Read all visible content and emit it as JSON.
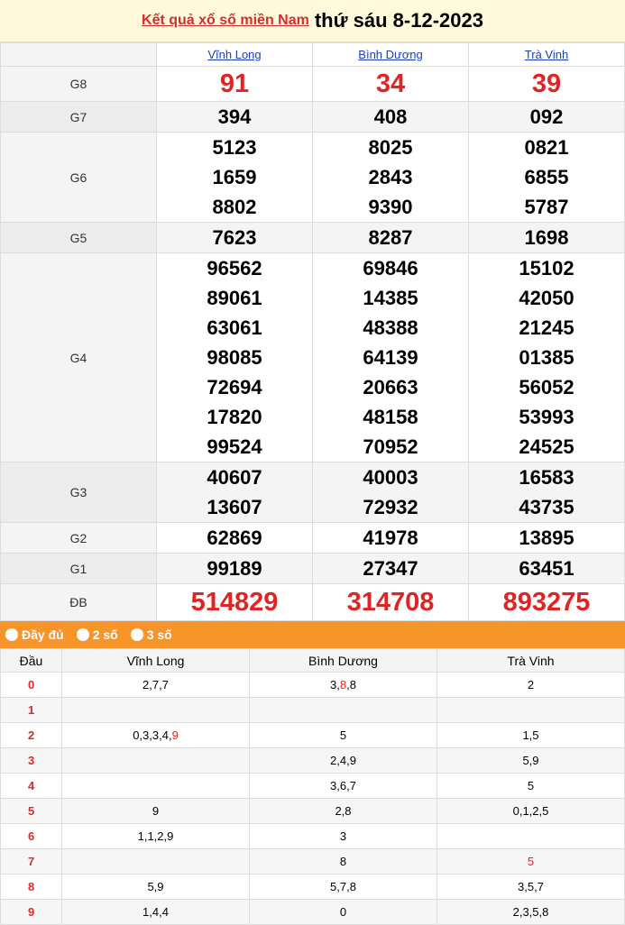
{
  "header": {
    "link_text": "Kết quả xổ số miền Nam",
    "date_text": "thứ sáu 8-12-2023"
  },
  "provinces": [
    "Vĩnh Long",
    "Bình Dương",
    "Trà Vinh"
  ],
  "prizes": [
    {
      "label": "G8",
      "values": [
        [
          "91"
        ],
        [
          "34"
        ],
        [
          "39"
        ]
      ]
    },
    {
      "label": "G7",
      "values": [
        [
          "394"
        ],
        [
          "408"
        ],
        [
          "092"
        ]
      ]
    },
    {
      "label": "G6",
      "values": [
        [
          "5123",
          "1659",
          "8802"
        ],
        [
          "8025",
          "2843",
          "9390"
        ],
        [
          "0821",
          "6855",
          "5787"
        ]
      ]
    },
    {
      "label": "G5",
      "values": [
        [
          "7623"
        ],
        [
          "8287"
        ],
        [
          "1698"
        ]
      ]
    },
    {
      "label": "G4",
      "values": [
        [
          "96562",
          "89061",
          "63061",
          "98085",
          "72694",
          "17820",
          "99524"
        ],
        [
          "69846",
          "14385",
          "48388",
          "64139",
          "20663",
          "48158",
          "70952"
        ],
        [
          "15102",
          "42050",
          "21245",
          "01385",
          "56052",
          "53993",
          "24525"
        ]
      ]
    },
    {
      "label": "G3",
      "values": [
        [
          "40607",
          "13607"
        ],
        [
          "40003",
          "72932"
        ],
        [
          "16583",
          "43735"
        ]
      ]
    },
    {
      "label": "G2",
      "values": [
        [
          "62869"
        ],
        [
          "41978"
        ],
        [
          "13895"
        ]
      ]
    },
    {
      "label": "G1",
      "values": [
        [
          "99189"
        ],
        [
          "27347"
        ],
        [
          "63451"
        ]
      ]
    },
    {
      "label": "ĐB",
      "values": [
        [
          "514829"
        ],
        [
          "314708"
        ],
        [
          "893275"
        ]
      ]
    }
  ],
  "toolbar": {
    "opt_full": "Đầy đủ",
    "opt_2": "2 số",
    "opt_3": "3 số"
  },
  "loto": {
    "head_label": "Đầu",
    "rows": [
      {
        "dau": "0",
        "cells": [
          [
            {
              "t": "2,7,7"
            }
          ],
          [
            {
              "t": "3,"
            },
            {
              "t": "8",
              "hl": true
            },
            {
              "t": ",8"
            }
          ],
          [
            {
              "t": "2"
            }
          ]
        ]
      },
      {
        "dau": "1",
        "cells": [
          [],
          [],
          []
        ]
      },
      {
        "dau": "2",
        "cells": [
          [
            {
              "t": "0,3,3,4,"
            },
            {
              "t": "9",
              "hl": true
            }
          ],
          [
            {
              "t": "5"
            }
          ],
          [
            {
              "t": "1,5"
            }
          ]
        ]
      },
      {
        "dau": "3",
        "cells": [
          [],
          [
            {
              "t": "2,4,9"
            }
          ],
          [
            {
              "t": "5,9"
            }
          ]
        ]
      },
      {
        "dau": "4",
        "cells": [
          [],
          [
            {
              "t": "3,6,7"
            }
          ],
          [
            {
              "t": "5"
            }
          ]
        ]
      },
      {
        "dau": "5",
        "cells": [
          [
            {
              "t": "9"
            }
          ],
          [
            {
              "t": "2,8"
            }
          ],
          [
            {
              "t": "0,1,2,5"
            }
          ]
        ]
      },
      {
        "dau": "6",
        "cells": [
          [
            {
              "t": "1,1,2,9"
            }
          ],
          [
            {
              "t": "3"
            }
          ],
          []
        ]
      },
      {
        "dau": "7",
        "cells": [
          [],
          [
            {
              "t": "8"
            }
          ],
          [
            {
              "t": "5",
              "hl": true
            }
          ]
        ]
      },
      {
        "dau": "8",
        "cells": [
          [
            {
              "t": "5,9"
            }
          ],
          [
            {
              "t": "5,7,8"
            }
          ],
          [
            {
              "t": "3,5,7"
            }
          ]
        ]
      },
      {
        "dau": "9",
        "cells": [
          [
            {
              "t": "1,4,4"
            }
          ],
          [
            {
              "t": "0"
            }
          ],
          [
            {
              "t": "2,3,5,8"
            }
          ]
        ]
      }
    ]
  }
}
